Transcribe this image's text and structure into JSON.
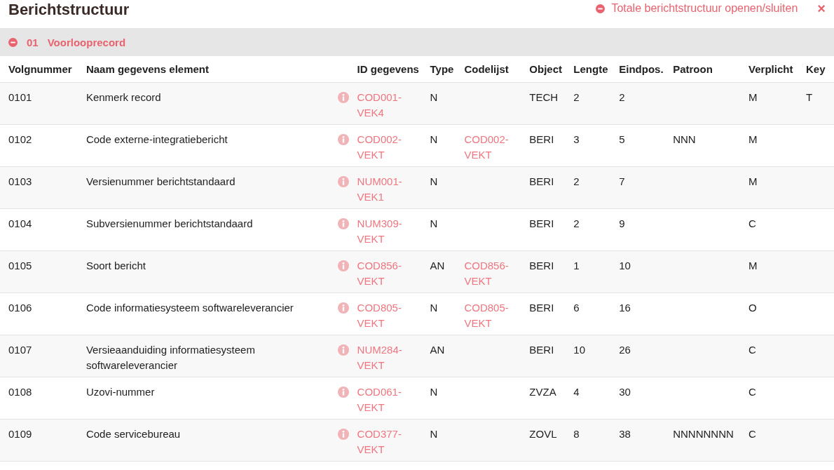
{
  "title": "Berichtstructuur",
  "toggle_all": {
    "label": "Totale berichtstructuur openen/sluiten",
    "expanded": true
  },
  "close": "×",
  "section": {
    "number": "01",
    "name": "Voorlooprecord",
    "expanded": true
  },
  "columns": [
    "Volgnummer",
    "Naam gegevens element",
    "ID gegevens",
    "Type",
    "Codelijst",
    "Object",
    "Lengte",
    "Eindpos.",
    "Patroon",
    "Verplicht",
    "Key"
  ],
  "rows": [
    {
      "nr": "0101",
      "name": "Kenmerk record",
      "id": "COD001-VEK4",
      "type": "N",
      "codelist": "",
      "object": "TECH",
      "length": "2",
      "endpos": "2",
      "pattern": "",
      "required": "M",
      "key": "T"
    },
    {
      "nr": "0102",
      "name": "Code externe-integratiebericht",
      "id": "COD002-VEKT",
      "type": "N",
      "codelist": "COD002-VEKT",
      "object": "BERI",
      "length": "3",
      "endpos": "5",
      "pattern": "NNN",
      "required": "M",
      "key": ""
    },
    {
      "nr": "0103",
      "name": "Versienummer berichtstandaard",
      "id": "NUM001-VEK1",
      "type": "N",
      "codelist": "",
      "object": "BERI",
      "length": "2",
      "endpos": "7",
      "pattern": "",
      "required": "M",
      "key": ""
    },
    {
      "nr": "0104",
      "name": "Subversienummer berichtstandaard",
      "id": "NUM309-VEKT",
      "type": "N",
      "codelist": "",
      "object": "BERI",
      "length": "2",
      "endpos": "9",
      "pattern": "",
      "required": "C",
      "key": ""
    },
    {
      "nr": "0105",
      "name": "Soort bericht",
      "id": "COD856-VEKT",
      "type": "AN",
      "codelist": "COD856-VEKT",
      "object": "BERI",
      "length": "1",
      "endpos": "10",
      "pattern": "",
      "required": "M",
      "key": ""
    },
    {
      "nr": "0106",
      "name": "Code informatiesysteem softwareleverancier",
      "id": "COD805-VEKT",
      "type": "N",
      "codelist": "COD805-VEKT",
      "object": "BERI",
      "length": "6",
      "endpos": "16",
      "pattern": "",
      "required": "O",
      "key": ""
    },
    {
      "nr": "0107",
      "name": "Versieaanduiding informatiesysteem softwareleverancier",
      "id": "NUM284-VEKT",
      "type": "AN",
      "codelist": "",
      "object": "BERI",
      "length": "10",
      "endpos": "26",
      "pattern": "",
      "required": "C",
      "key": ""
    },
    {
      "nr": "0108",
      "name": "Uzovi-nummer",
      "id": "COD061-VEKT",
      "type": "N",
      "codelist": "",
      "object": "ZVZA",
      "length": "4",
      "endpos": "30",
      "pattern": "",
      "required": "C",
      "key": ""
    },
    {
      "nr": "0109",
      "name": "Code servicebureau",
      "id": "COD377-VEKT",
      "type": "N",
      "codelist": "",
      "object": "ZOVL",
      "length": "8",
      "endpos": "38",
      "pattern": "NNNNNNNN",
      "required": "C",
      "key": ""
    }
  ]
}
